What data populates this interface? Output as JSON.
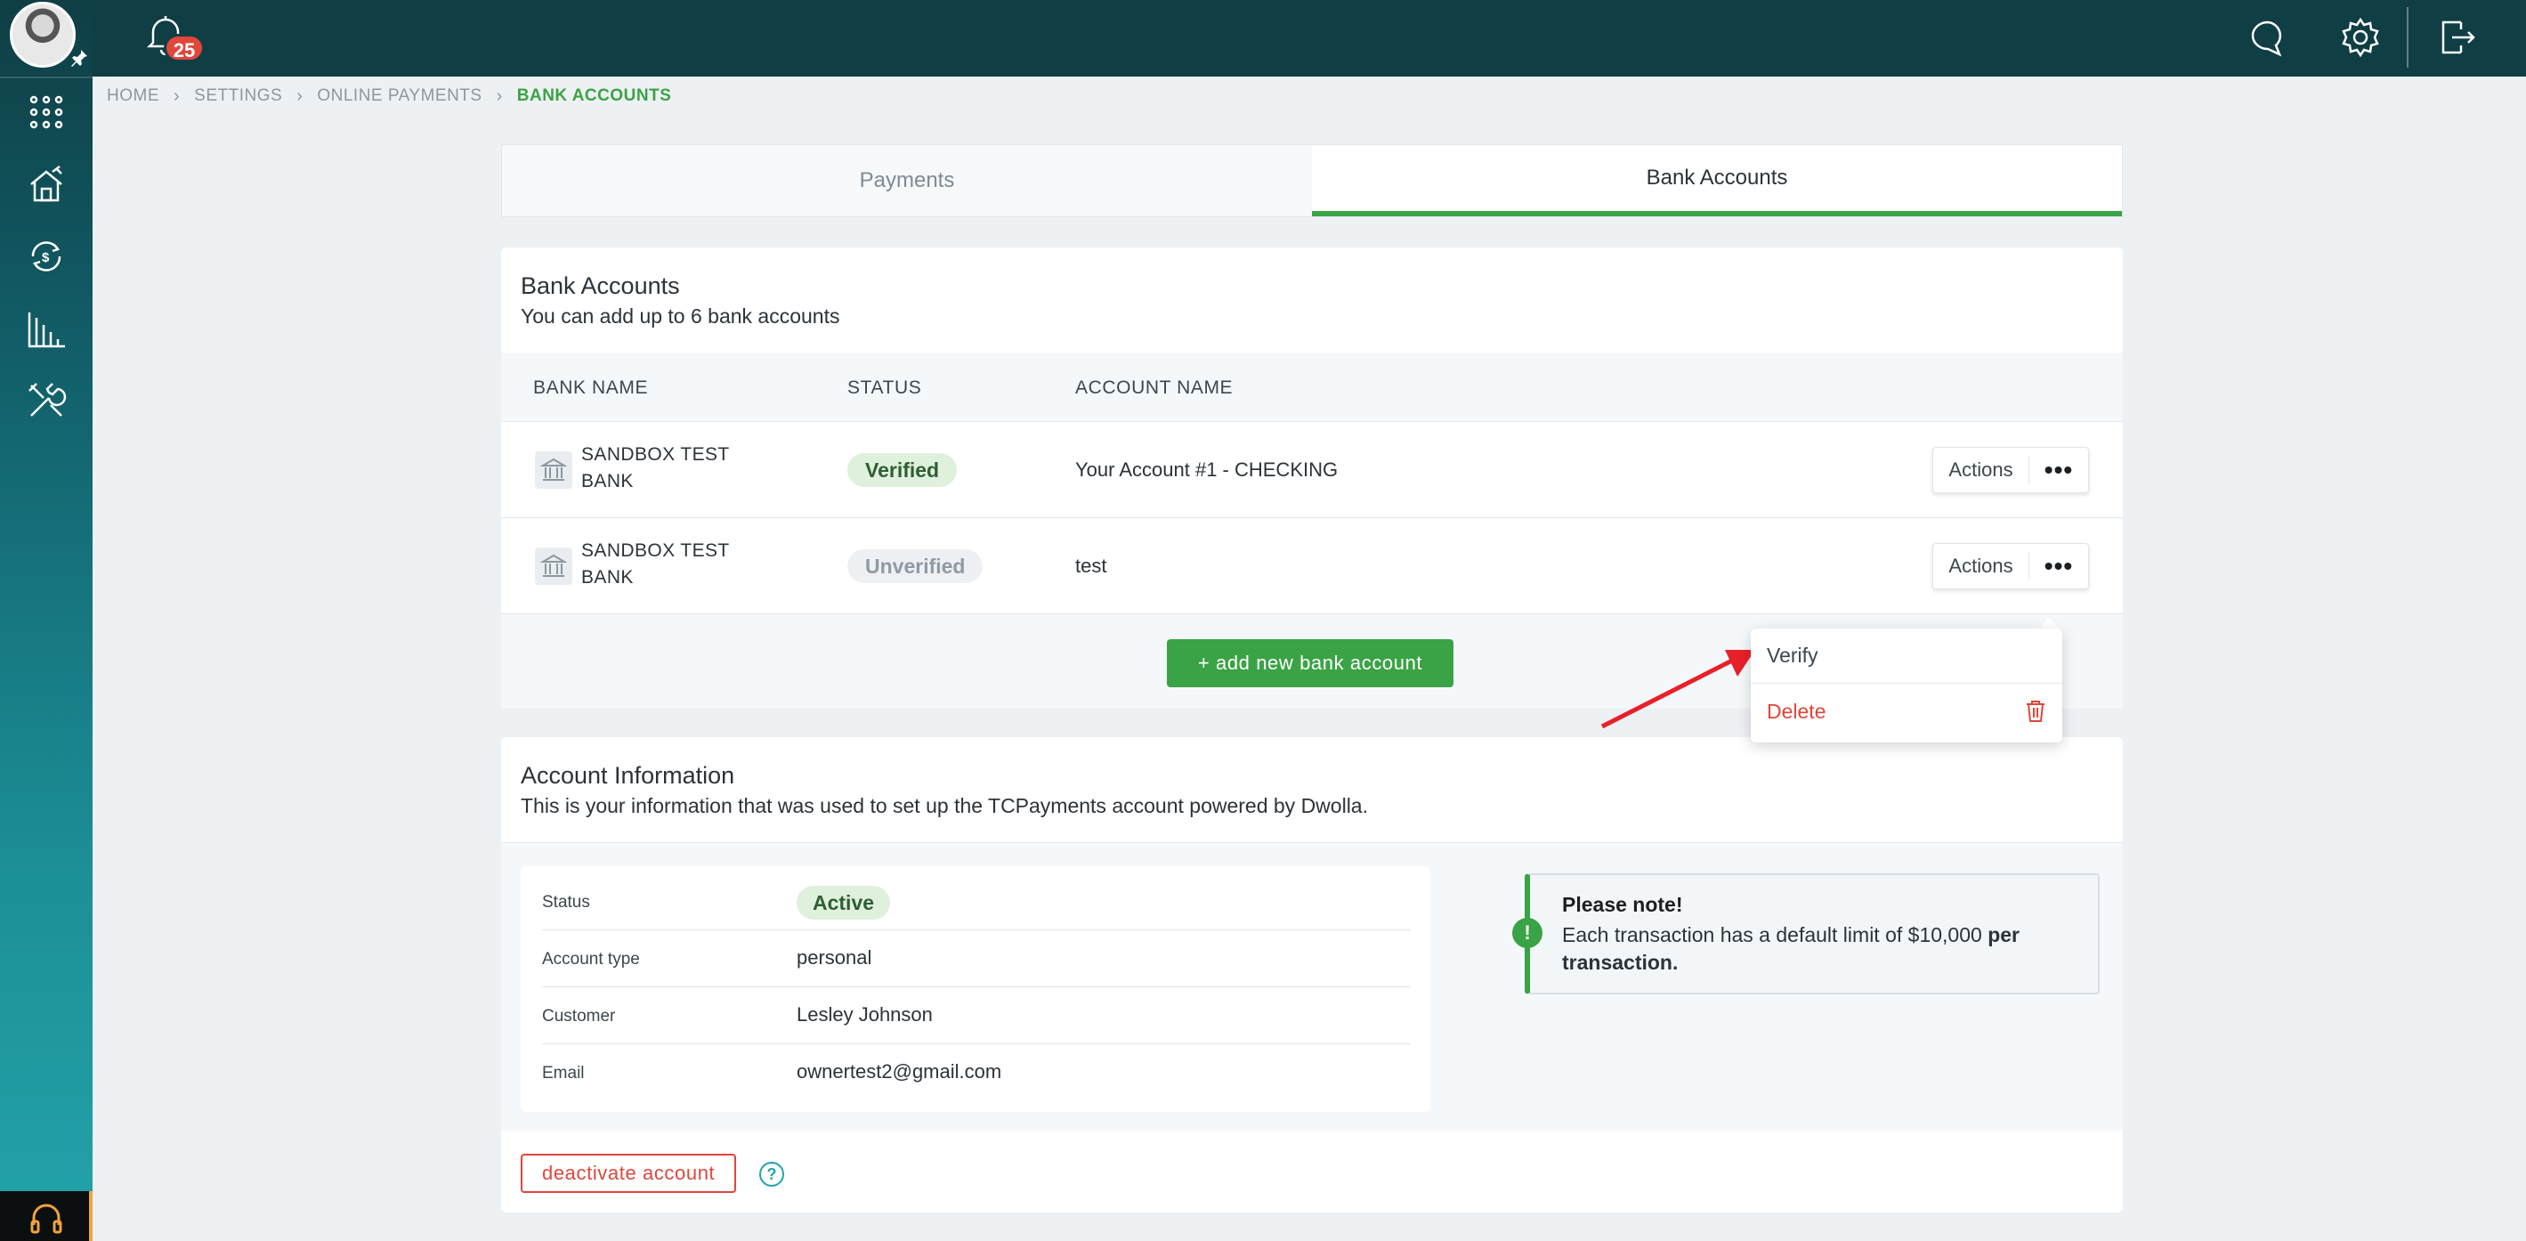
{
  "notifications": {
    "count": "25"
  },
  "breadcrumb": {
    "items": [
      "HOME",
      "SETTINGS",
      "ONLINE PAYMENTS",
      "BANK ACCOUNTS"
    ]
  },
  "tabs": [
    {
      "label": "Payments",
      "active": false
    },
    {
      "label": "Bank Accounts",
      "active": true
    }
  ],
  "bank_accounts": {
    "title": "Bank Accounts",
    "subtitle": "You can add up to 6 bank accounts",
    "columns": [
      "BANK NAME",
      "STATUS",
      "ACCOUNT NAME"
    ],
    "rows": [
      {
        "bank_name_line1": "SANDBOX TEST",
        "bank_name_line2": "BANK",
        "status": "Verified",
        "account_name": "Your Account #1 - CHECKING",
        "actions_label": "Actions"
      },
      {
        "bank_name_line1": "SANDBOX TEST",
        "bank_name_line2": "BANK",
        "status": "Unverified",
        "account_name": "test",
        "actions_label": "Actions"
      }
    ],
    "add_button": "+ add new bank account"
  },
  "actions_menu": {
    "items": [
      "Verify",
      "Delete"
    ]
  },
  "account_info": {
    "title": "Account Information",
    "subtitle": "This is your information that was used to set up the TCPayments account powered by Dwolla.",
    "fields": [
      {
        "label": "Status",
        "value": "Active"
      },
      {
        "label": "Account type",
        "value": "personal"
      },
      {
        "label": "Customer",
        "value": "Lesley Johnson"
      },
      {
        "label": "Email",
        "value": "ownertest2@gmail.com"
      }
    ],
    "note": {
      "title": "Please note!",
      "text_prefix": "Each transaction has a default limit of $10,000 ",
      "text_bold": "per transaction."
    },
    "deactivate_button": "deactivate account",
    "help_glyph": "?"
  },
  "colors": {
    "brand_green": "#3aa345",
    "danger": "#e0463a",
    "topbar": "#0f3e45",
    "teal": "#23a3aa"
  }
}
